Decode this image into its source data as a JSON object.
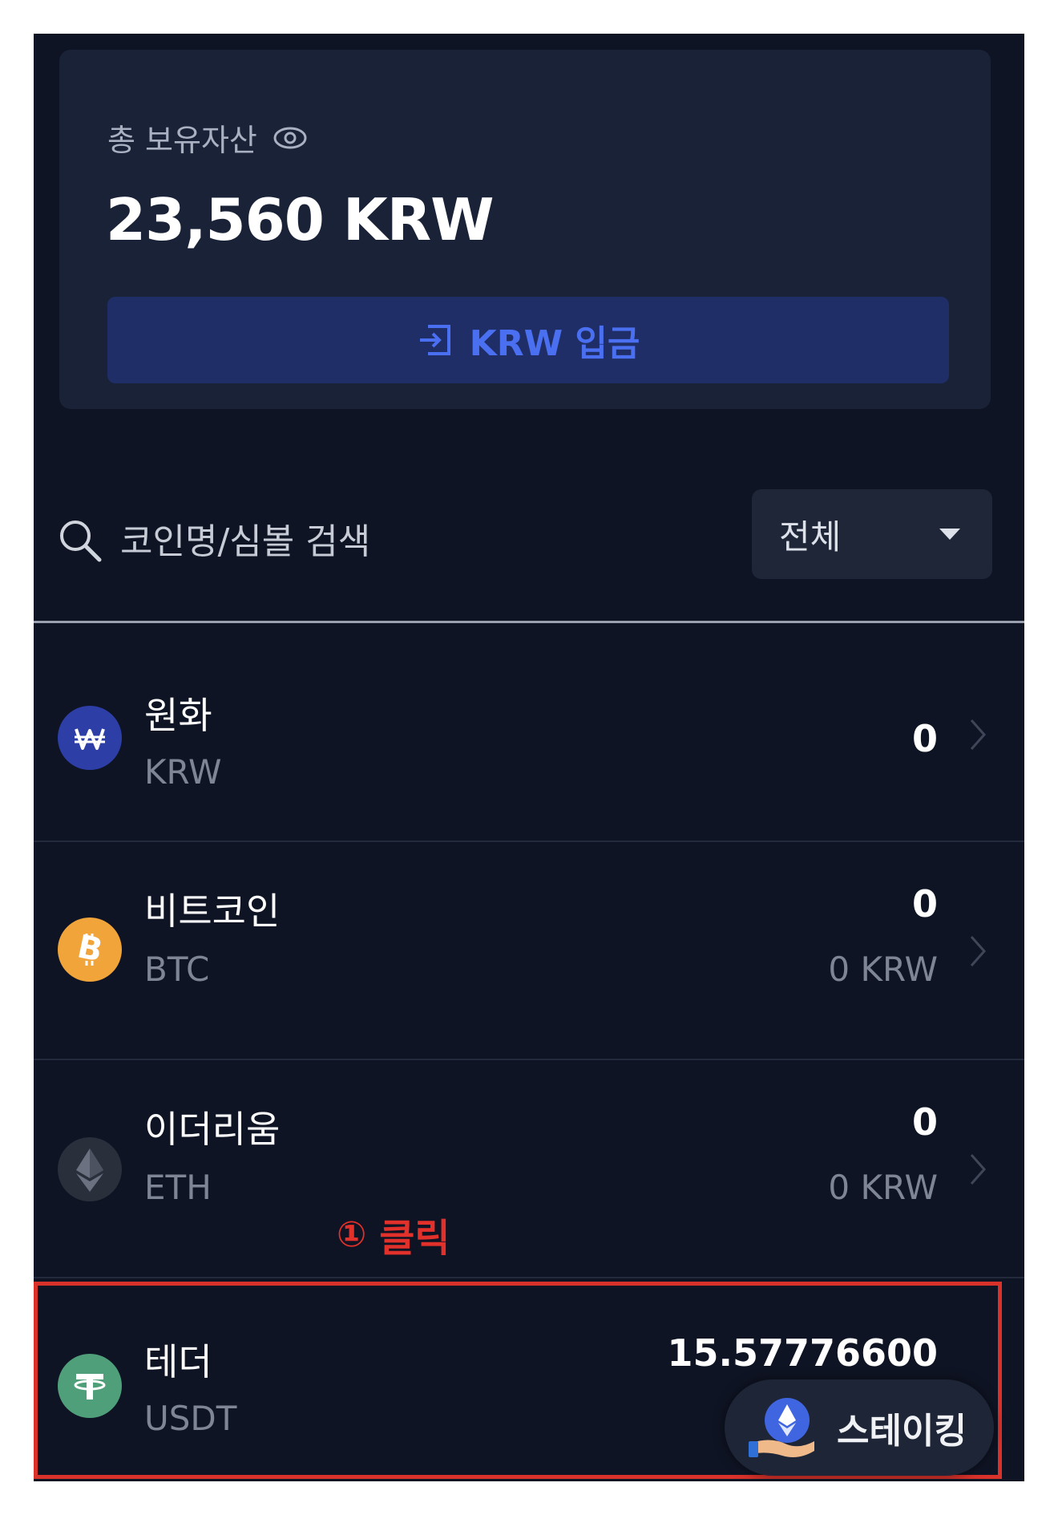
{
  "summary": {
    "label": "총 보유자산",
    "total": "23,560 KRW",
    "deposit_label": "KRW 입금"
  },
  "search": {
    "placeholder": "코인명/심볼 검색",
    "filter_value": "전체"
  },
  "coins": [
    {
      "name": "원화",
      "symbol": "KRW",
      "quantity": "0",
      "krw_value": "",
      "icon": "won-icon",
      "color": "#2d3ea6"
    },
    {
      "name": "비트코인",
      "symbol": "BTC",
      "quantity": "0",
      "krw_value": "0 KRW",
      "icon": "bitcoin-icon",
      "color": "#f0a43a"
    },
    {
      "name": "이더리움",
      "symbol": "ETH",
      "quantity": "0",
      "krw_value": "0 KRW",
      "icon": "ethereum-icon",
      "color": "#2a2f3c"
    },
    {
      "name": "테더",
      "symbol": "USDT",
      "quantity": "15.57776600",
      "krw_value": "",
      "icon": "tether-icon",
      "color": "#4fa07a"
    }
  ],
  "annotation": {
    "marker": "①",
    "text": "클릭",
    "color": "#e2302a"
  },
  "staking": {
    "label": "스테이킹"
  }
}
